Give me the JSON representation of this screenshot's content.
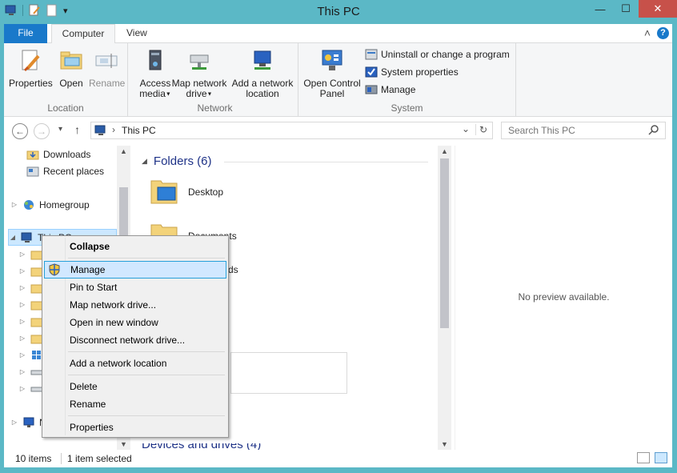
{
  "window": {
    "title": "This PC"
  },
  "quick_access": {
    "dropdown": "▾"
  },
  "window_buttons": {
    "minimize": "—",
    "maximize": "☐",
    "close": "✕"
  },
  "ribbon_tabs": {
    "file": "File",
    "computer": "Computer",
    "view": "View"
  },
  "ribbon_controls": {
    "collapse": "˄",
    "help": "?"
  },
  "ribbon": {
    "location": {
      "label": "Location",
      "properties": "Properties",
      "open": "Open",
      "rename": "Rename"
    },
    "network": {
      "label": "Network",
      "access_media_1": "Access",
      "access_media_2": "media",
      "map_drive_1": "Map network",
      "map_drive_2": "drive",
      "add_location_1": "Add a network",
      "add_location_2": "location"
    },
    "system": {
      "label": "System",
      "open_cp_1": "Open Control",
      "open_cp_2": "Panel",
      "uninstall": "Uninstall or change a program",
      "sys_props": "System properties",
      "manage": "Manage"
    }
  },
  "navigation": {
    "back": "←",
    "forward": "→",
    "recent": "▾",
    "up": "↑"
  },
  "address": {
    "path": "This PC",
    "sep": "›",
    "dropdown": "⌄",
    "refresh": "↻"
  },
  "search": {
    "placeholder": "Search This PC"
  },
  "nav_pane": {
    "downloads": "Downloads",
    "recent": "Recent places",
    "homegroup": "Homegroup",
    "this_pc": "This PC",
    "network": "N"
  },
  "main": {
    "folders_header": "Folders (6)",
    "desktop": "Desktop",
    "documents": "Documents",
    "downloads_partial": "ds",
    "devices_partial": "Devices and drives (4)"
  },
  "preview": {
    "text": "No preview available."
  },
  "status": {
    "items": "10 items",
    "selected": "1 item selected"
  },
  "context_menu": {
    "collapse": "Collapse",
    "manage": "Manage",
    "pin": "Pin to Start",
    "map_drive": "Map network drive...",
    "open_new": "Open in new window",
    "disconnect": "Disconnect network drive...",
    "add_location": "Add a network location",
    "delete": "Delete",
    "rename": "Rename",
    "properties": "Properties"
  },
  "colors": {
    "frame": "#5bb8c6",
    "file_tab": "#1979ca",
    "close": "#c7514a",
    "selection": "#cce8ff",
    "menu_hover": "#d1e8ff"
  }
}
